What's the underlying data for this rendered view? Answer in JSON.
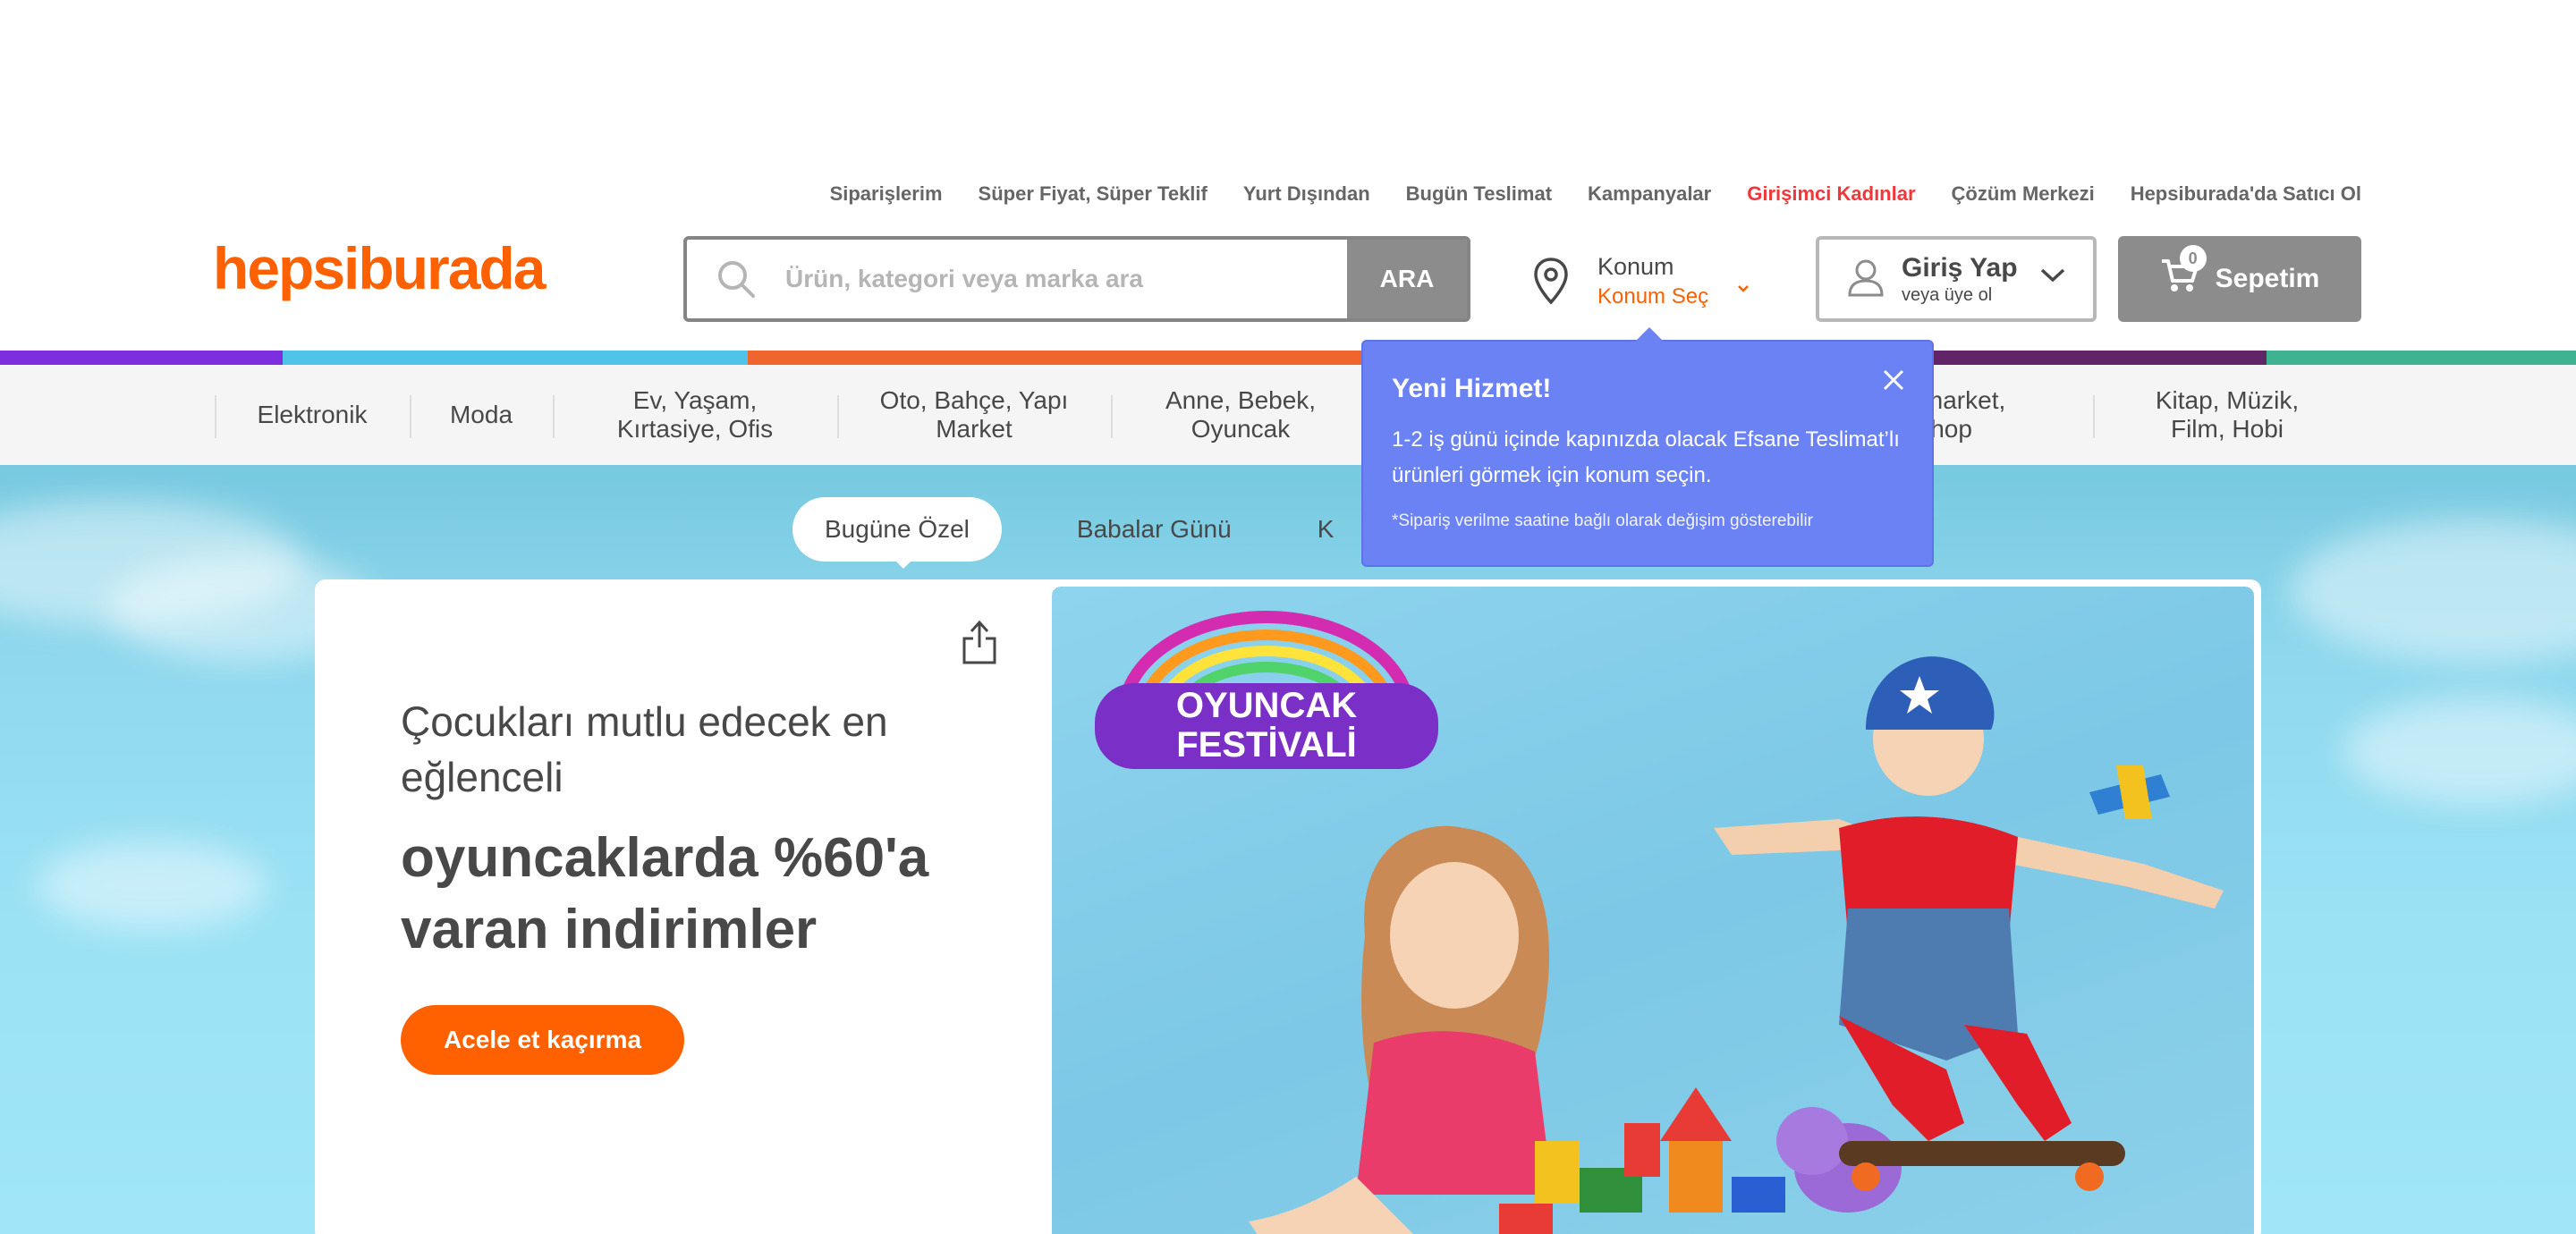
{
  "top_links": [
    {
      "label": "Siparişlerim",
      "highlight": false
    },
    {
      "label": "Süper Fiyat, Süper Teklif",
      "highlight": false
    },
    {
      "label": "Yurt Dışından",
      "highlight": false
    },
    {
      "label": "Bugün Teslimat",
      "highlight": false
    },
    {
      "label": "Kampanyalar",
      "highlight": false
    },
    {
      "label": "Girişimci Kadınlar",
      "highlight": true
    },
    {
      "label": "Çözüm Merkezi",
      "highlight": false
    },
    {
      "label": "Hepsiburada'da Satıcı Ol",
      "highlight": false
    }
  ],
  "logo": "hepsiburada",
  "search": {
    "placeholder": "Ürün, kategori veya marka ara",
    "button": "ARA"
  },
  "location": {
    "title": "Konum",
    "action": "Konum Seç"
  },
  "login": {
    "title": "Giriş Yap",
    "subtitle": "veya üye ol"
  },
  "cart": {
    "label": "Sepetim",
    "count": "0"
  },
  "categories": [
    {
      "label": "Elektronik"
    },
    {
      "label": "Moda"
    },
    {
      "label": "Ev, Yaşam,\nKırtasiye, Ofis"
    },
    {
      "label": "Oto, Bahçe, Yapı\nMarket"
    },
    {
      "label": "Anne, Bebek,\nOyuncak"
    },
    {
      "label": "ermarket,\nt Shop"
    },
    {
      "label": "Kitap, Müzik,\nFilm, Hobi"
    }
  ],
  "tabs": [
    {
      "label": "Bugüne Özel",
      "active": true
    },
    {
      "label": "Babalar Günü",
      "active": false
    },
    {
      "label": "K",
      "active": false
    }
  ],
  "hero": {
    "line1": "Çocukları mutlu edecek en eğlenceli",
    "line2": "oyuncaklarda %60'a varan indirimler",
    "cta": "Acele et kaçırma",
    "badge_line1": "OYUNCAK",
    "badge_line2": "FESTİVALİ"
  },
  "popup": {
    "title": "Yeni Hizmet!",
    "body": "1-2 iş günü içinde kapınızda olacak Efsane Teslimat’lı ürünleri görmek için konum seçin.",
    "note": "*Sipariş verilme saatine bağlı olarak değişim gösterebilir"
  },
  "colors": {
    "brand": "#ff6000",
    "popup": "#6b82f5",
    "bar": [
      "#7b2fde",
      "#4fc3e8",
      "#f0642e",
      "#612466",
      "#3db394"
    ]
  }
}
